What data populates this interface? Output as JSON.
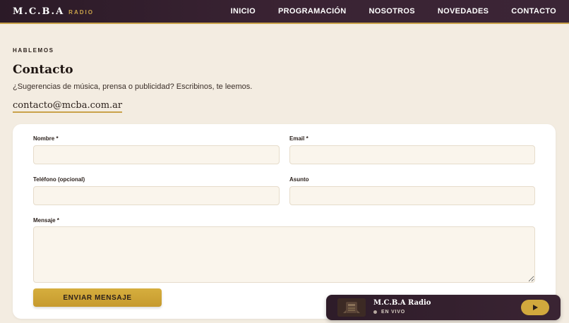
{
  "header": {
    "brand": "M.C.B.A",
    "brand_sub": "RADIO",
    "nav": [
      "INICIO",
      "PROGRAMACIÓN",
      "NOSOTROS",
      "NOVEDADES",
      "CONTACTO"
    ]
  },
  "contact": {
    "eyebrow": "HABLEMOS",
    "title": "Contacto",
    "subtitle": "¿Sugerencias de música, prensa o publicidad? Escribinos, te leemos.",
    "email": "contacto@mcba.com.ar"
  },
  "form": {
    "name_label": "Nombre *",
    "email_label": "Email *",
    "phone_label": "Teléfono (opcional)",
    "subject_label": "Asunto",
    "message_label": "Mensaje *",
    "name_value": "",
    "email_value": "",
    "phone_value": "",
    "subject_value": "",
    "message_value": "",
    "submit_label": "ENVIAR MENSAJE"
  },
  "player": {
    "title": "M.C.B.A Radio",
    "status": "EN VIVO"
  },
  "colors": {
    "background": "#f3ece1",
    "header": "#2b1a27",
    "accent_gold": "#c9a24a",
    "button_gold": "#d1a83d"
  }
}
